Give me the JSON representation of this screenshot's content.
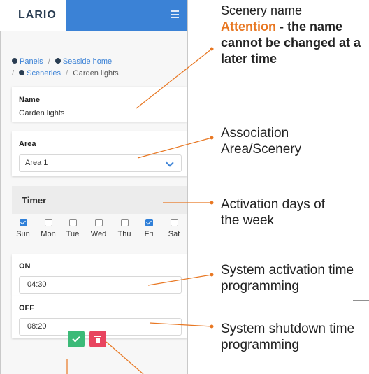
{
  "app": {
    "logo_text": "LARIO"
  },
  "breadcrumb": {
    "items": [
      "Panels",
      "Seaside home",
      "Sceneries",
      "Garden lights"
    ],
    "separator": "/"
  },
  "form": {
    "name_label": "Name",
    "name_value": "Garden lights",
    "area_label": "Area",
    "area_value": "Area 1",
    "timer_title": "Timer",
    "days": [
      {
        "label": "Sun",
        "checked": true
      },
      {
        "label": "Mon",
        "checked": false
      },
      {
        "label": "Tue",
        "checked": false
      },
      {
        "label": "Wed",
        "checked": false
      },
      {
        "label": "Thu",
        "checked": false
      },
      {
        "label": "Fri",
        "checked": true
      },
      {
        "label": "Sat",
        "checked": false
      }
    ],
    "on_label": "ON",
    "on_value": "04:30",
    "off_label": "OFF",
    "off_value": "08:20"
  },
  "annotations": {
    "scenery_name": "Scenery name",
    "attention_word": "Attention",
    "attention_rest": " - the name cannot be changed at a later time",
    "association_line1": "Association",
    "association_line2": "Area/Scenery",
    "activation_line1": "Activation days of",
    "activation_line2": "the week",
    "activation_time_line1": "System activation time",
    "activation_time_line2": "programming",
    "shutdown_time_line1": "System shutdown time",
    "shutdown_time_line2": "programming"
  },
  "colors": {
    "accent_blue": "#3b82d6",
    "annotation_orange": "#e87722",
    "save_green": "#3cba78",
    "delete_red": "#e8445f"
  },
  "icons": {
    "menu": "hamburger-icon",
    "select": "chevron-down-icon",
    "save": "check-icon",
    "delete": "trash-icon"
  }
}
